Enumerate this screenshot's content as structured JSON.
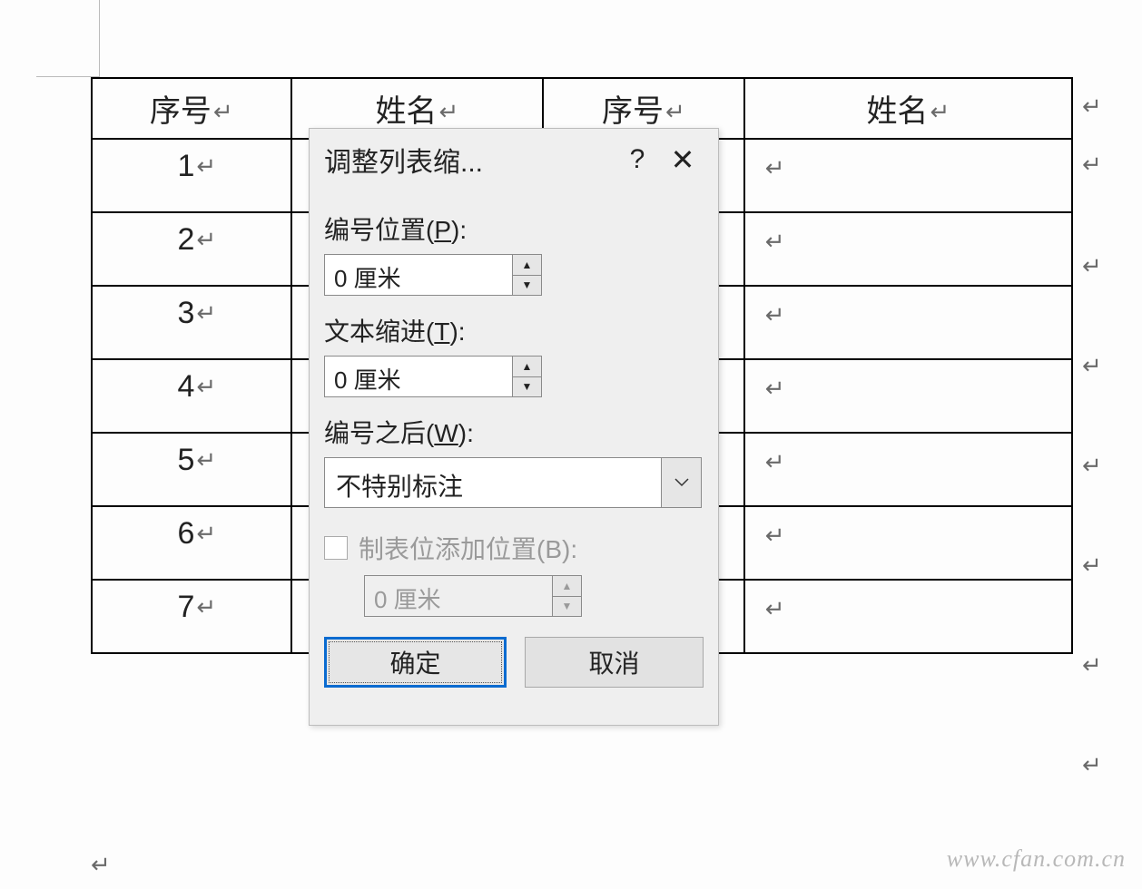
{
  "marks": {
    "return": "↵"
  },
  "table": {
    "headers": [
      "序号",
      "姓名",
      "序号",
      "姓名"
    ],
    "rows": [
      {
        "num": "1"
      },
      {
        "num": "2"
      },
      {
        "num": "3"
      },
      {
        "num": "4"
      },
      {
        "num": "5"
      },
      {
        "num": "6"
      },
      {
        "num": "7"
      }
    ]
  },
  "dialog": {
    "title": "调整列表缩...",
    "help": "?",
    "close": "✕",
    "number_pos_label_pre": "编号位置(",
    "number_pos_label_u": "P",
    "number_pos_label_post": "):",
    "number_pos_value": "0 厘米",
    "text_indent_label_pre": "文本缩进(",
    "text_indent_label_u": "T",
    "text_indent_label_post": "):",
    "text_indent_value": "0 厘米",
    "after_num_label_pre": "编号之后(",
    "after_num_label_u": "W",
    "after_num_label_post": "):",
    "after_num_value": "不特别标注",
    "tab_label": "制表位添加位置(B):",
    "tab_value": "0 厘米",
    "ok": "确定",
    "cancel": "取消"
  },
  "watermark": "www.cfan.com.cn"
}
